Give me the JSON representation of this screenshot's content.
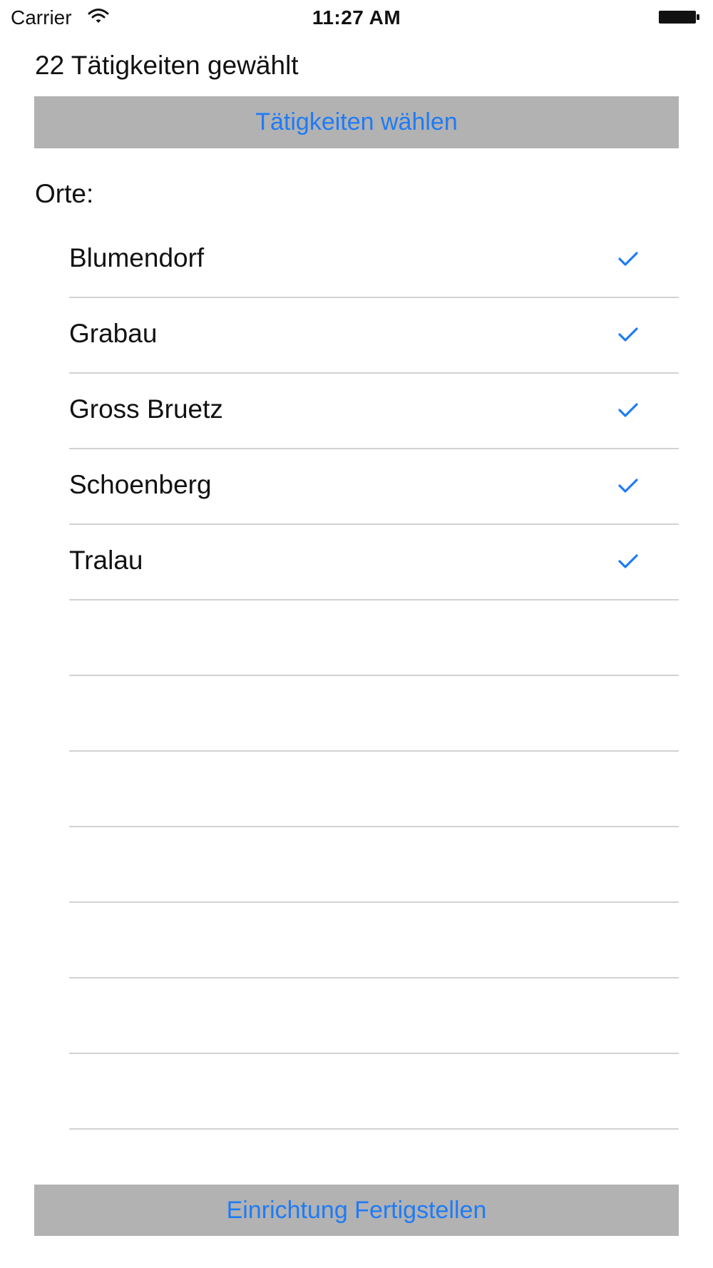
{
  "status_bar": {
    "carrier": "Carrier",
    "time": "11:27 AM",
    "wifi_icon": "wifi-icon",
    "battery_icon": "battery-icon"
  },
  "header": {
    "selection_count": "22 Tätigkeiten gewählt",
    "select_activities_label": "Tätigkeiten wählen"
  },
  "places": {
    "label": "Orte:",
    "items": [
      {
        "label": "Blumendorf",
        "checked": true
      },
      {
        "label": "Grabau",
        "checked": true
      },
      {
        "label": "Gross Bruetz",
        "checked": true
      },
      {
        "label": "Schoenberg",
        "checked": true
      },
      {
        "label": "Tralau",
        "checked": true
      },
      {
        "label": "",
        "checked": false
      },
      {
        "label": "",
        "checked": false
      },
      {
        "label": "",
        "checked": false
      },
      {
        "label": "",
        "checked": false
      },
      {
        "label": "",
        "checked": false
      },
      {
        "label": "",
        "checked": false
      },
      {
        "label": "",
        "checked": false
      }
    ]
  },
  "footer": {
    "finish_label": "Einrichtung Fertigstellen"
  },
  "colors": {
    "accent": "#1f7bf5",
    "button_background": "#b2b2b2",
    "separator": "#d2d2d2"
  }
}
